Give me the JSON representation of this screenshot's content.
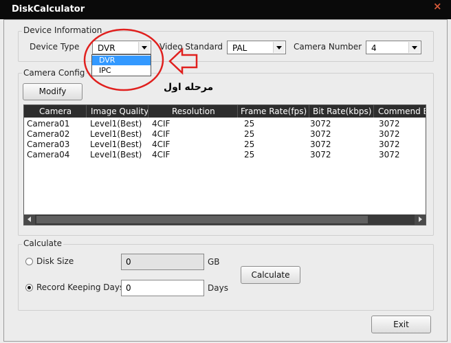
{
  "window": {
    "title": "DiskCalculator",
    "close_glyph": "×"
  },
  "device_information": {
    "legend": "Device Information",
    "device_type_label": "Device Type",
    "device_type_value": "DVR",
    "device_type_options": [
      "DVR",
      "IPC"
    ],
    "video_standard_label": "Video Standard",
    "video_standard_value": "PAL",
    "camera_number_label": "Camera Number",
    "camera_number_value": "4"
  },
  "camera_config": {
    "legend": "Camera Config",
    "modify_label": "Modify",
    "columns": [
      "Camera",
      "Image Quality",
      "Resolution",
      "Frame Rate(fps)",
      "Bit Rate(kbps)",
      "Commend B"
    ],
    "rows": [
      [
        "Camera01",
        "Level1(Best)",
        "4CIF",
        "25",
        "3072",
        "3072"
      ],
      [
        "Camera02",
        "Level1(Best)",
        "4CIF",
        "25",
        "3072",
        "3072"
      ],
      [
        "Camera03",
        "Level1(Best)",
        "4CIF",
        "25",
        "3072",
        "3072"
      ],
      [
        "Camera04",
        "Level1(Best)",
        "4CIF",
        "25",
        "3072",
        "3072"
      ]
    ]
  },
  "annotation": {
    "text": "مرحله اول",
    "color": "#e0201e"
  },
  "calculate": {
    "legend": "Calculate",
    "disk_size_label": "Disk Size",
    "disk_size_value": "0",
    "disk_size_unit": "GB",
    "days_label": "Record Keeping Days",
    "days_value": "0",
    "days_unit": "Days",
    "calculate_label": "Calculate",
    "selected_option": "Record Keeping Days"
  },
  "footer": {
    "exit_label": "Exit"
  }
}
